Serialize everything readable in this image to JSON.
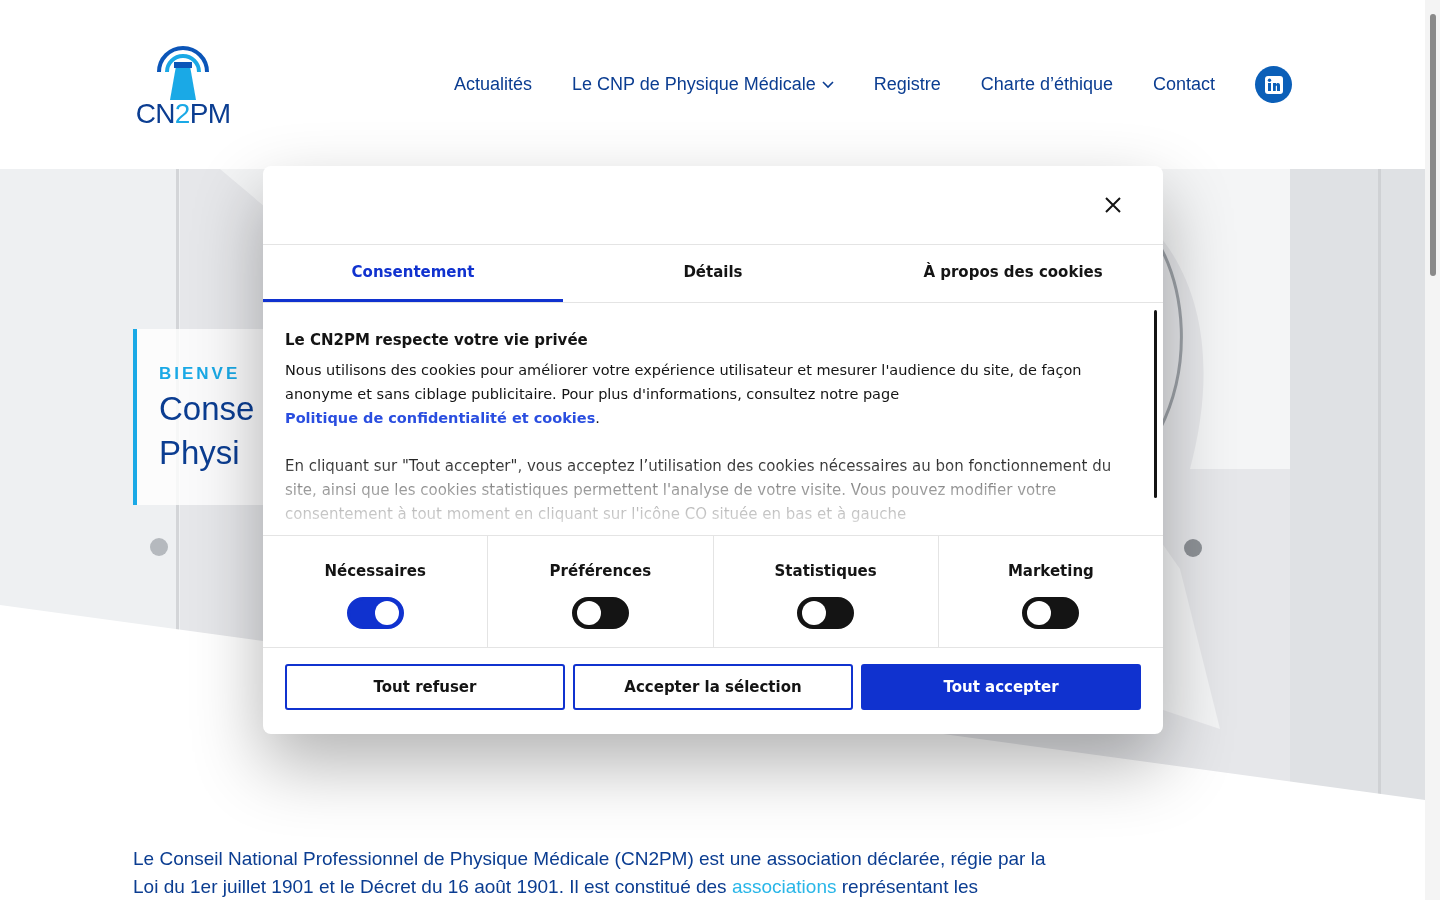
{
  "header": {
    "logo_parts": [
      "CN",
      "2",
      "PM"
    ],
    "nav": [
      {
        "label": "Actualités",
        "dropdown": false
      },
      {
        "label": "Le CNP de Physique Médicale",
        "dropdown": true
      },
      {
        "label": "Registre",
        "dropdown": false
      },
      {
        "label": "Charte d’éthique",
        "dropdown": false
      },
      {
        "label": "Contact",
        "dropdown": false
      }
    ]
  },
  "hero": {
    "kicker": "BIENVE",
    "title_lines": [
      "Conse",
      "Physi"
    ]
  },
  "intro": {
    "before": "Le Conseil National Professionnel de Physique Médicale (CN2PM) est une association déclarée, régie par la Loi du 1er juillet 1901 et le Décret du 16 août 1901. Il est constitué des ",
    "link": "associations",
    "after": " représentant les"
  },
  "cookie_dialog": {
    "tabs": [
      {
        "label": "Consentement",
        "selected": true
      },
      {
        "label": "Détails",
        "selected": false
      },
      {
        "label": "À propos des cookies",
        "selected": false
      }
    ],
    "heading": "Le CN2PM respecte votre vie privée",
    "paragraph_1": {
      "text": "Nous utilisons des cookies pour améliorer votre expérience utilisateur et mesurer l'audience du site, de façon anonyme et sans ciblage publicitaire. Pour plus d'informations, consultez notre page ",
      "link": "Politique de confidentialité et cookies",
      "end": "."
    },
    "paragraph_2": "En cliquant sur \"Tout accepter\", vous acceptez l’utilisation des cookies nécessaires au bon fonctionnement du site, ainsi que les cookies statistiques permettent l'analyse de votre visite. Vous pouvez modifier votre consentement à tout moment en cliquant sur l'icône CO située en bas et à gauche",
    "categories": [
      {
        "label": "Nécessaires",
        "on": true
      },
      {
        "label": "Préférences",
        "on": false
      },
      {
        "label": "Statistiques",
        "on": false
      },
      {
        "label": "Marketing",
        "on": false
      }
    ],
    "buttons": [
      {
        "label": "Tout refuser",
        "kind": "outline"
      },
      {
        "label": "Accepter la sélection",
        "kind": "outline"
      },
      {
        "label": "Tout accepter",
        "kind": "primary"
      }
    ]
  }
}
